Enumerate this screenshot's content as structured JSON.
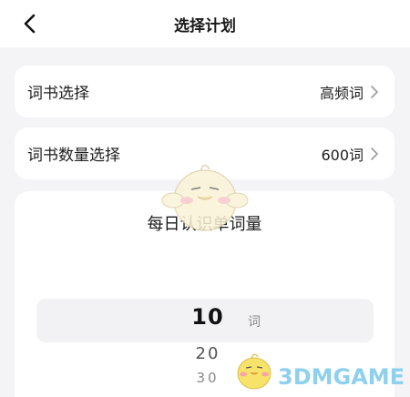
{
  "header": {
    "title": "选择计划",
    "back_icon": "chevron-left-icon"
  },
  "rows": [
    {
      "label": "词书选择",
      "value": "高频词"
    },
    {
      "label": "词书数量选择",
      "value": "600词"
    }
  ],
  "picker": {
    "title": "每日认识单词量",
    "selected_value": "10",
    "unit": "词",
    "options_below": [
      "20",
      "30"
    ]
  },
  "watermark": {
    "text": "3DMGAME",
    "color": "#8ed0ee"
  },
  "colors": {
    "background": "#f4f4f6",
    "card": "#ffffff",
    "highlight": "#f2f2f4"
  }
}
